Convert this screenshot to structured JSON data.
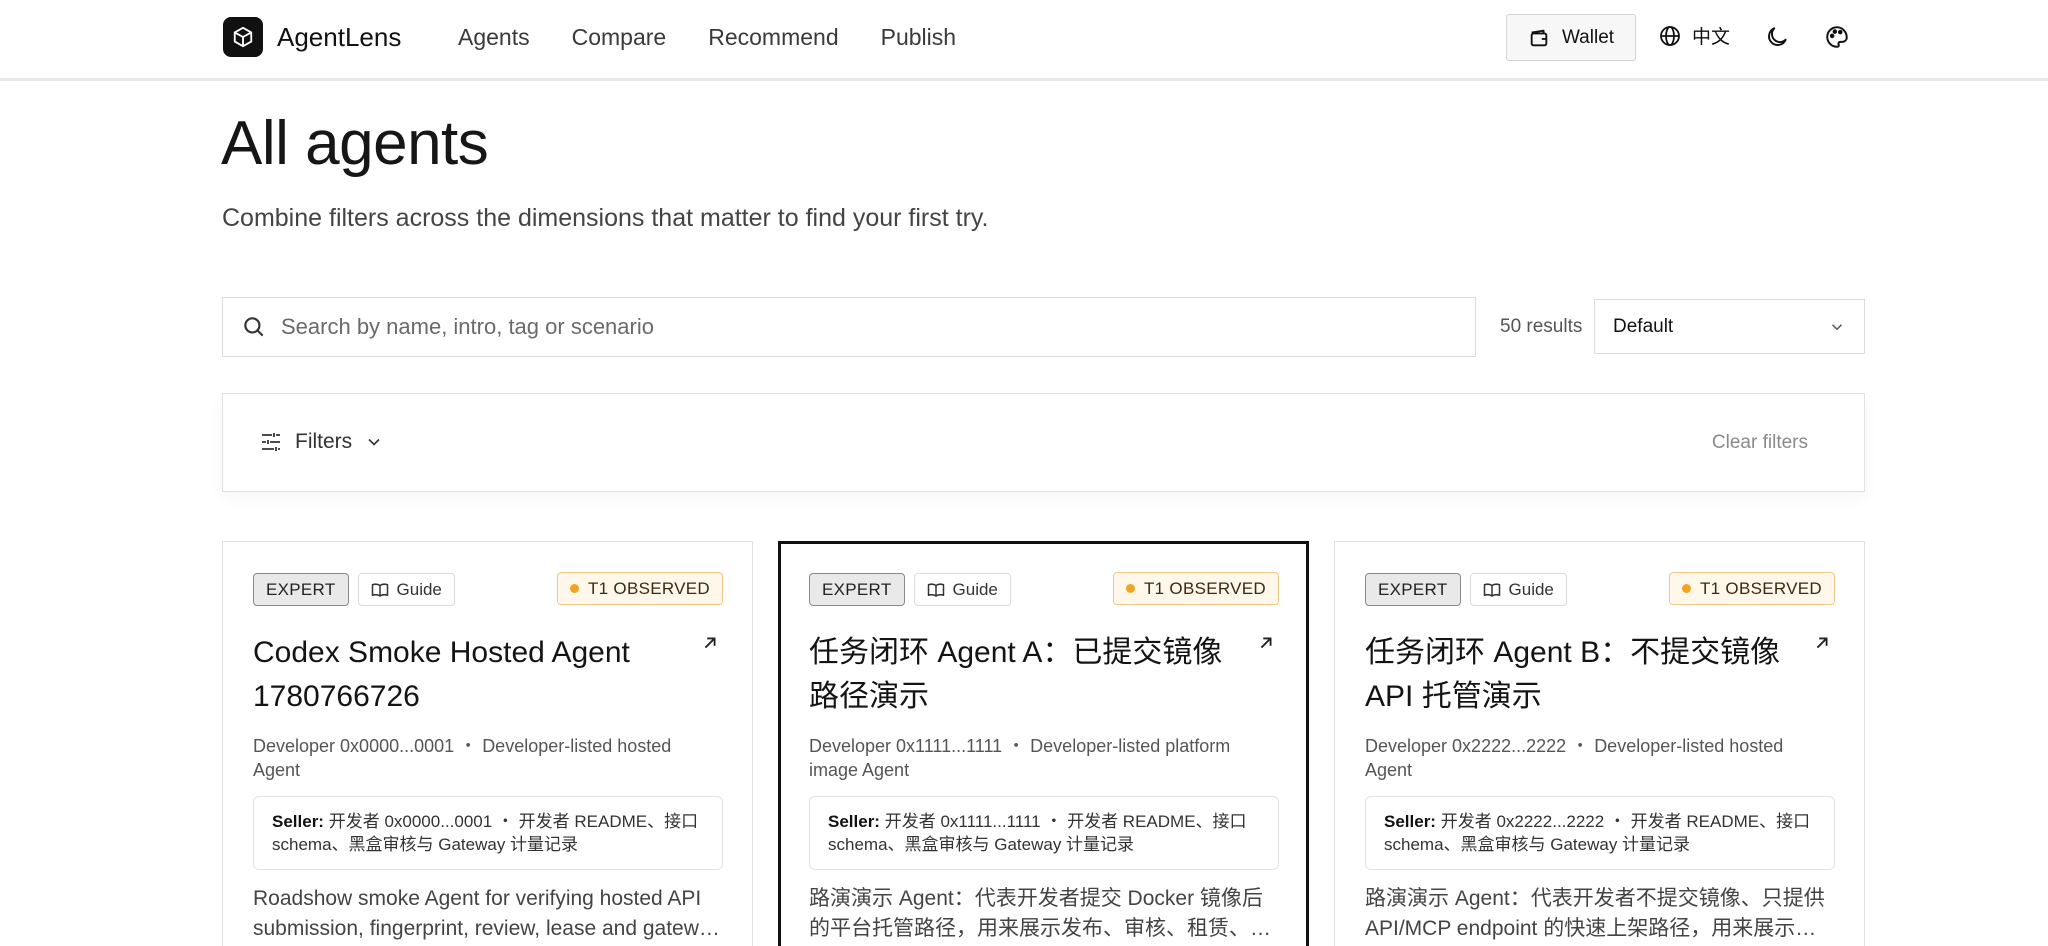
{
  "header": {
    "brand": "AgentLens",
    "nav": [
      "Agents",
      "Compare",
      "Recommend",
      "Publish"
    ],
    "wallet_label": "Wallet",
    "lang_label": "中文"
  },
  "page": {
    "title": "All agents",
    "subtitle": "Combine filters across the dimensions that matter to find your first try."
  },
  "search": {
    "placeholder": "Search by name, intro, tag or scenario",
    "results": "50 results",
    "sort_value": "Default"
  },
  "filters": {
    "label": "Filters",
    "clear_label": "Clear filters"
  },
  "cards": [
    {
      "tier": "EXPERT",
      "guide": "Guide",
      "status": "T1 OBSERVED",
      "title": "Codex Smoke Hosted Agent 1780766726",
      "developer": "Developer 0x0000...0001",
      "listing": "Developer-listed hosted Agent",
      "seller_label": "Seller:",
      "seller_text": "开发者 0x0000...0001 ・ 开发者 README、接口 schema、黑盒审核与 Gateway 计量记录",
      "desc": "Roadshow smoke Agent for verifying hosted API submission, fingerprint, review, lease and gateway metering."
    },
    {
      "tier": "EXPERT",
      "guide": "Guide",
      "status": "T1 OBSERVED",
      "title": "任务闭环 Agent A：已提交镜像路径演示",
      "developer": "Developer 0x1111...1111",
      "listing": "Developer-listed platform image Agent",
      "seller_label": "Seller:",
      "seller_text": "开发者 0x1111...1111 ・ 开发者 README、接口 schema、黑盒审核与 Gateway 计量记录",
      "desc": "路演演示 Agent：代表开发者提交 Docker 镜像后的平台托管路径，用来展示发布、审核、租赁、调用与计量。"
    },
    {
      "tier": "EXPERT",
      "guide": "Guide",
      "status": "T1 OBSERVED",
      "title": "任务闭环 Agent B：不提交镜像 API 托管演示",
      "developer": "Developer 0x2222...2222",
      "listing": "Developer-listed hosted Agent",
      "seller_label": "Seller:",
      "seller_text": "开发者 0x2222...2222 ・ 开发者 README、接口 schema、黑盒审核与 Gateway 计量记录",
      "desc": "路演演示 Agent：代表开发者不提交镜像、只提供 API/MCP endpoint 的快速上架路径，用来展示托管与计量。"
    }
  ]
}
